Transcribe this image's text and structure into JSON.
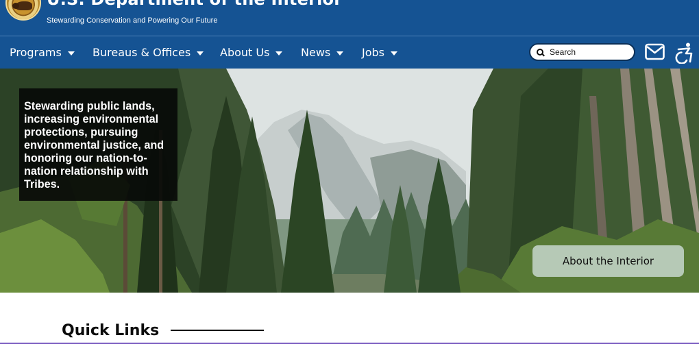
{
  "header": {
    "title": "U.S. Department of the Interior",
    "tagline": "Stewarding Conservation and Powering Our Future"
  },
  "nav": {
    "items": [
      {
        "label": "Programs"
      },
      {
        "label": "Bureaus & Offices"
      },
      {
        "label": "About Us"
      },
      {
        "label": "News"
      },
      {
        "label": "Jobs"
      }
    ],
    "search_placeholder": "Search",
    "icons": [
      "search-icon",
      "mail-icon",
      "accessibility-icon",
      "caret-down-icon"
    ]
  },
  "hero": {
    "mission_text": "Stewarding public lands, increasing environmental protections, pursuing environmental justice, and honoring our nation-to-nation relationship with Tribes.",
    "cta_label": "About the Interior"
  },
  "quick_links": {
    "title": "Quick Links"
  },
  "colors": {
    "header_blue": "#155393",
    "cta_green": "#b6c9b6",
    "card_black": "#080a08"
  }
}
